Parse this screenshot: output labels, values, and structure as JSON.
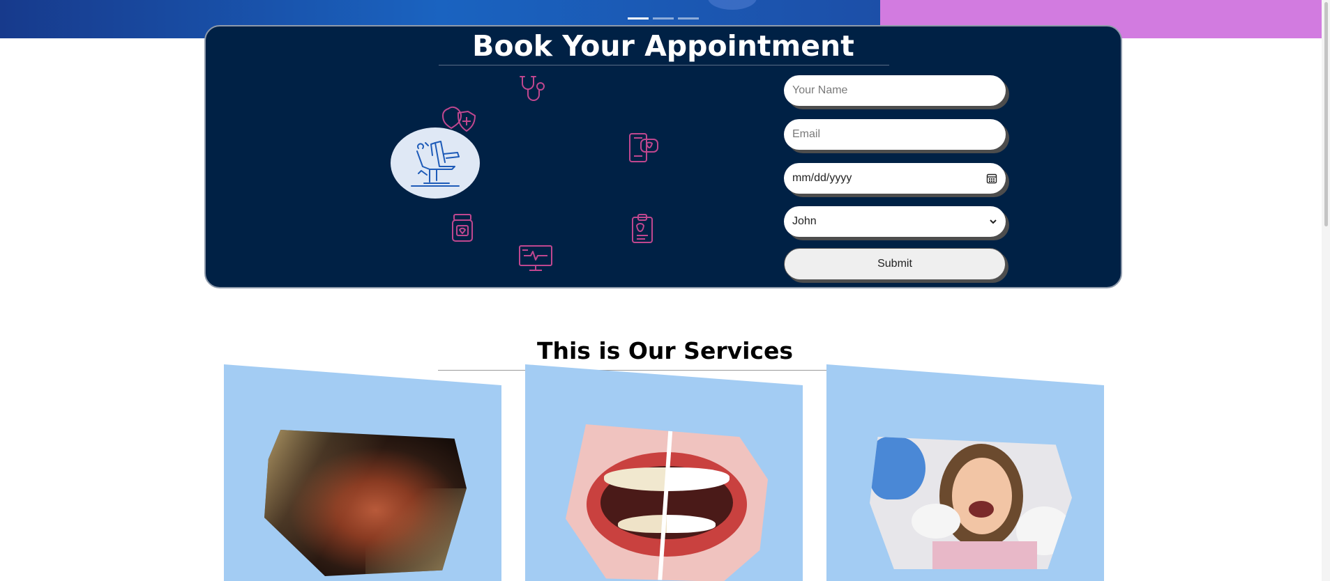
{
  "hero": {
    "carousel_dots": [
      {
        "label": "",
        "active": true
      },
      {
        "label": "",
        "active": false
      },
      {
        "label": "",
        "active": false
      }
    ],
    "colors": {
      "left": "#1a63c0",
      "right": "#d27be0"
    }
  },
  "appointment": {
    "title": "Book Your Appointment",
    "form": {
      "name_placeholder": "Your Name",
      "email_placeholder": "Email",
      "date_placeholder": "mm/dd/yyyy",
      "doctor_selected": "John",
      "submit_label": "Submit"
    },
    "icons": [
      "stethoscope-icon",
      "shield-heart-icon",
      "mobile-chat-icon",
      "dental-chair-icon",
      "medicine-jar-icon",
      "clipboard-icon",
      "monitor-pulse-icon"
    ],
    "colors": {
      "panel": "#002145",
      "icon_accent": "#c0478f",
      "chair_line": "#1e5bb8"
    }
  },
  "services": {
    "title": "This is Our Services",
    "cards": [
      {
        "image": "dental-procedure-photo"
      },
      {
        "image": "teeth-whitening-photo"
      },
      {
        "image": "child-dental-checkup-photo"
      }
    ],
    "colors": {
      "card": "#a3ccf3"
    }
  }
}
